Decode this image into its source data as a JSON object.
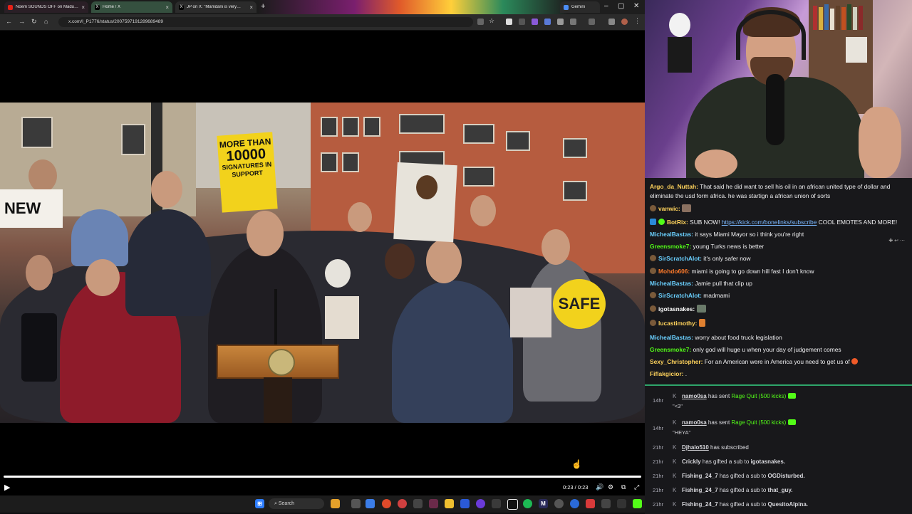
{
  "browser": {
    "tabs": [
      {
        "title": "Noem SOUNDS OFF on Madu…",
        "icon": "youtube-icon"
      },
      {
        "title": "Home / X",
        "icon": "x-icon"
      },
      {
        "title": "JP on X: \"Mamdani is very…",
        "icon": "x-icon"
      },
      {
        "title": "Gemini",
        "icon": "gemini-icon"
      }
    ],
    "url": "x.com/I_P1776/status/2007597191289689489"
  },
  "video": {
    "sign_line1": "MORE THAN",
    "sign_big": "10000",
    "sign_line2": "SIGNATURES IN SUPPORT",
    "sign_new": "NEW",
    "sign_safe": "SAFE",
    "timecode": "0:23 / 0:23"
  },
  "taskbar": {
    "search_label": "Search"
  },
  "chat": {
    "messages": [
      {
        "user": "Argo_da_Nuttah:",
        "color": "#ffd35c",
        "text": "That said he did want to sell his oil in an african united type of dollar and eliminate the usd form africa. he was startign a african union of sorts"
      },
      {
        "user": "vanwic:",
        "color": "#ffd35c",
        "text": ""
      },
      {
        "user": "BotRix:",
        "color": "#ffd35c",
        "text": "SUB NOW!",
        "link": "https://kick.com/bonelinks/subscribe",
        "text2": "COOL EMOTES AND MORE!"
      },
      {
        "user": "MichealBastas:",
        "color": "#6ad0ff",
        "text": "it says Miami Mayor so i think you're right"
      },
      {
        "user": "Greensmoke7:",
        "color": "#53fc18",
        "text": "young Turks news is better"
      },
      {
        "user": "SirScratchAlot:",
        "color": "#6ad0ff",
        "text": "it's only safer now"
      },
      {
        "user": "Mohdo606:",
        "color": "#ff7a2a",
        "text": "miami is going to go down hill fast I don't know"
      },
      {
        "user": "MichealBastas:",
        "color": "#6ad0ff",
        "text": "Jamie pull that clip up"
      },
      {
        "user": "SirScratchAlot:",
        "color": "#6ad0ff",
        "text": "madmami"
      },
      {
        "user": "igotasnakes:",
        "color": "#ffffff",
        "text": ""
      },
      {
        "user": "lucastimothy:",
        "color": "#ffd35c",
        "text": ""
      },
      {
        "user": "MichealBastas:",
        "color": "#6ad0ff",
        "text": "worry about food truck legislation"
      },
      {
        "user": "Greensmoke7:",
        "color": "#53fc18",
        "text": "only god will huge u when your day of judgement comes"
      },
      {
        "user": "Sexy_Christopher:",
        "color": "#ffd35c",
        "text": "For an American were in America you need to get us of"
      },
      {
        "user": "Fiflakgicior:",
        "color": "#ffd35c",
        "text": "."
      }
    ]
  },
  "events": [
    {
      "time": "14hr",
      "name": "namo0sa",
      "mid": "has sent",
      "item": "Rage Quit (500 kicks)",
      "note": "\"<3\""
    },
    {
      "time": "14hr",
      "name": "namo0sa",
      "mid": "has sent",
      "item": "Rage Quit (500 kicks)",
      "note": "\"HEYA\""
    },
    {
      "time": "21hr",
      "name": "Djhalo510",
      "mid": "has subscribed",
      "target": ""
    },
    {
      "time": "21hr",
      "name": "Crickly",
      "mid": "has gifted a sub to",
      "target": "igotasnakes."
    },
    {
      "time": "21hr",
      "name": "Fishing_24_7",
      "mid": "has gifted a sub to",
      "target": "OGDisturbed."
    },
    {
      "time": "21hr",
      "name": "Fishing_24_7",
      "mid": "has gifted a sub to",
      "target": "that_guy."
    },
    {
      "time": "21hr",
      "name": "Fishing_24_7",
      "mid": "has gifted a sub to",
      "target": "QuesitoAlpina."
    }
  ]
}
